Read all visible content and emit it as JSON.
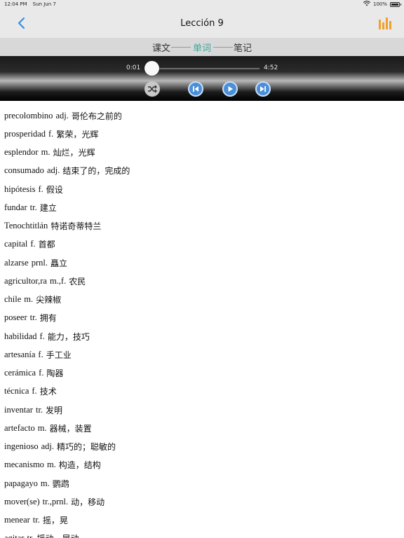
{
  "status_bar": {
    "time": "12:04 PM",
    "date": "Sun Jun 7",
    "battery": "100%",
    "wifi_icon": "wifi-icon"
  },
  "nav": {
    "title": "Lección 9",
    "back_icon": "chevron-left-icon",
    "stats_icon": "bar-chart-icon"
  },
  "tabs": [
    {
      "label": "课文",
      "active": false
    },
    {
      "label": "单词",
      "active": true
    },
    {
      "label": "笔记",
      "active": false
    }
  ],
  "player": {
    "current_time": "0:01",
    "total_time": "4:52",
    "progress": 0.003,
    "controls": [
      "shuffle-icon",
      "skip-previous-icon",
      "play-icon",
      "skip-next-icon"
    ]
  },
  "colors": {
    "accent": "#3aa8a0",
    "player_button": "#4a8fd8",
    "stats_icon": "#f0a030"
  },
  "vocab": [
    {
      "word": "precolombino",
      "gram": "adj.",
      "meaning": "哥伦布之前的"
    },
    {
      "word": "prosperidad",
      "gram": "f.",
      "meaning": "繁荣，光辉"
    },
    {
      "word": "esplendor",
      "gram": "m.",
      "meaning": "灿烂，光辉"
    },
    {
      "word": "consumado",
      "gram": "adj.",
      "meaning": "结束了的，完成的"
    },
    {
      "word": "hipótesis",
      "gram": "f.",
      "meaning": "假设"
    },
    {
      "word": "fundar",
      "gram": "tr.",
      "meaning": "建立"
    },
    {
      "word": "Tenochtitlán",
      "gram": "",
      "meaning": "特诺奇蒂特兰"
    },
    {
      "word": "capital",
      "gram": "f.",
      "meaning": "首都"
    },
    {
      "word": "alzarse",
      "gram": "prnl.",
      "meaning": "矗立"
    },
    {
      "word": "agricultor,ra",
      "gram": "m.,f.",
      "meaning": "农民"
    },
    {
      "word": "chile",
      "gram": "m.",
      "meaning": "尖辣椒"
    },
    {
      "word": "poseer",
      "gram": "tr.",
      "meaning": "拥有"
    },
    {
      "word": "habilidad",
      "gram": "f.",
      "meaning": "能力，技巧"
    },
    {
      "word": "artesanía",
      "gram": "f.",
      "meaning": "手工业"
    },
    {
      "word": "cerámica",
      "gram": "f.",
      "meaning": "陶器"
    },
    {
      "word": "técnica",
      "gram": "f.",
      "meaning": "技术"
    },
    {
      "word": "inventar",
      "gram": "tr.",
      "meaning": "发明"
    },
    {
      "word": "artefacto",
      "gram": "m.",
      "meaning": "器械，装置"
    },
    {
      "word": "ingenioso",
      "gram": "adj.",
      "meaning": "精巧的；聪敏的"
    },
    {
      "word": "mecanismo",
      "gram": "m.",
      "meaning": "构造，结构"
    },
    {
      "word": "papagayo",
      "gram": "m.",
      "meaning": "鹦鹉"
    },
    {
      "word": "mover(se)",
      "gram": "tr.,prnl.",
      "meaning": "动，移动"
    },
    {
      "word": "menear",
      "gram": "tr.",
      "meaning": "摇，晃"
    },
    {
      "word": "agitar",
      "gram": "tr.",
      "meaning": "摇动，晃动"
    }
  ]
}
